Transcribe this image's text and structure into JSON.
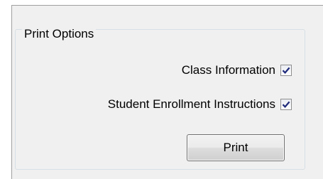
{
  "group": {
    "title": "Print Options"
  },
  "options": [
    {
      "label": "Class Information",
      "checked": true
    },
    {
      "label": "Student Enrollment Instructions",
      "checked": true
    }
  ],
  "buttons": {
    "print_label": "Print"
  },
  "colors": {
    "panel_background": "#f0f0f0",
    "check_mark": "#1e2a7a",
    "groupbox_border": "#d5dfe5"
  },
  "icons": {
    "checkbox_checked": "check-mark-icon"
  }
}
